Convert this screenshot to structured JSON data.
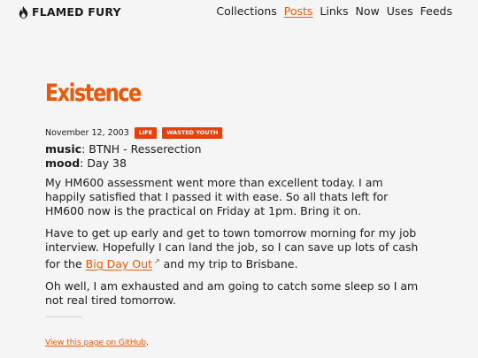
{
  "site": {
    "name": "FLAMED FURY",
    "logo_icon": "flame-icon"
  },
  "nav": [
    {
      "label": "Collections",
      "active": false
    },
    {
      "label": "Posts",
      "active": true
    },
    {
      "label": "Links",
      "active": false
    },
    {
      "label": "Now",
      "active": false
    },
    {
      "label": "Uses",
      "active": false
    },
    {
      "label": "Feeds",
      "active": false
    }
  ],
  "post": {
    "title": "Existence",
    "date": "November 12, 2003",
    "tags": [
      "LIFE",
      "WASTED YOUTH"
    ],
    "music_label": "music",
    "music_value": ": BTNH - Resserection",
    "mood_label": "mood",
    "mood_value": ": Day 38",
    "p1": "My HM600 assessment went more than excellent today. I am happily satisfied that I passed it with ease. So all thats left for HM600 now is the practical on Friday at 1pm. Bring it on.",
    "p2_before": "Have to get up early and get to town tomorrow morning for my job interview. Hopefully I can land the job, so I can save up lots of cash for the ",
    "p2_link": "Big Day Out",
    "p2_after": " and my trip to Brisbane.",
    "p3": "Oh well, I am exhausted and am going to catch some sleep so I am not real tired tomorrow."
  },
  "footer": {
    "link": "View this page on GitHub",
    "suffix": "."
  },
  "colors": {
    "accent": "#e8590c",
    "tag_bg": "#e8400c",
    "background": "#f5f5f5"
  }
}
